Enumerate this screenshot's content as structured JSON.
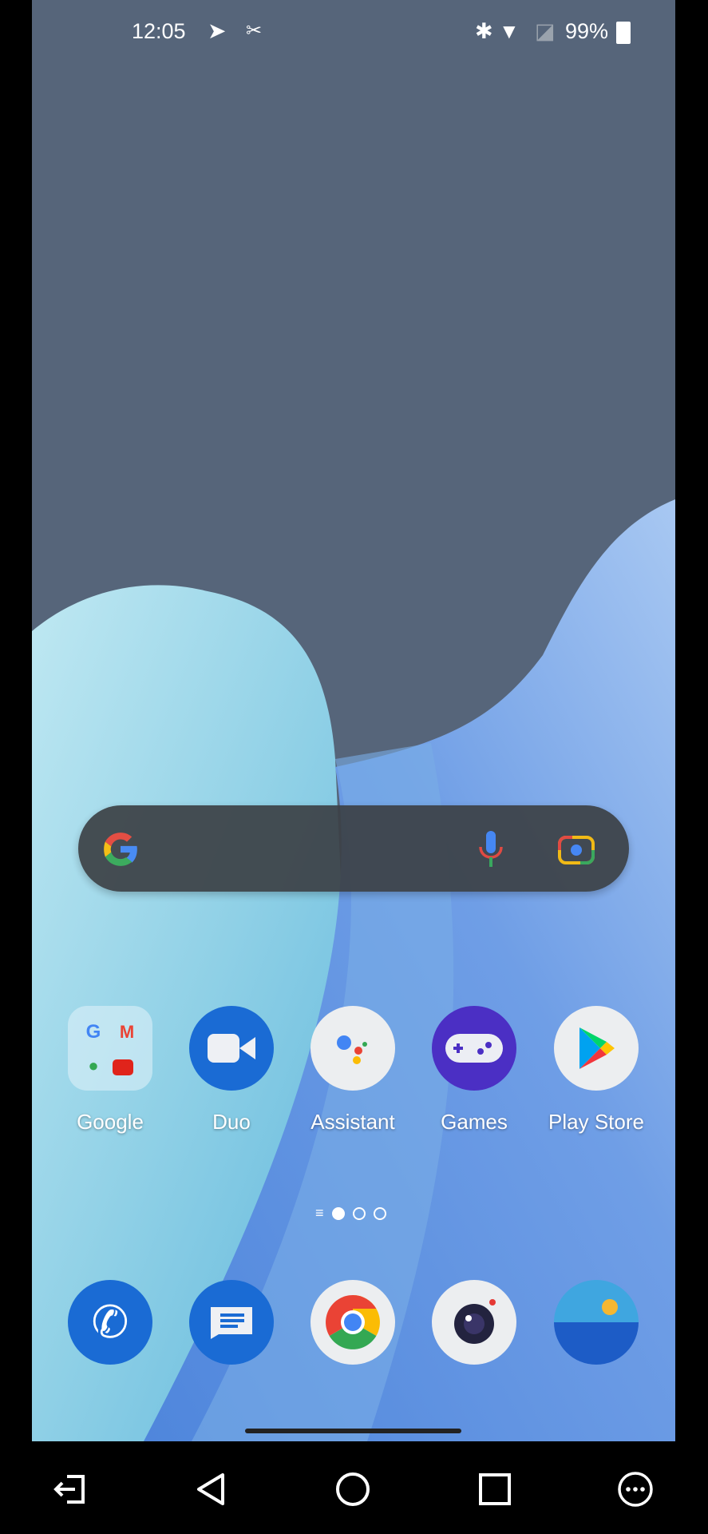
{
  "status_bar": {
    "time": "12:05",
    "battery": "99%",
    "icons": [
      "send-icon",
      "screenshot-scissors-icon",
      "bluetooth-icon",
      "wifi-icon",
      "no-sim-icon",
      "battery-icon"
    ]
  },
  "search_bar": {
    "icons": [
      "google-g-icon",
      "microphone-icon",
      "lens-camera-icon"
    ]
  },
  "apps": [
    {
      "label": "Google"
    },
    {
      "label": "Duo"
    },
    {
      "label": "Assistant"
    },
    {
      "label": "Games"
    },
    {
      "label": "Play Store"
    }
  ],
  "page_indicator": {
    "pages": 3,
    "current": 1
  },
  "dock": [
    "phone",
    "messages",
    "chrome",
    "camera",
    "gallery"
  ],
  "nav_bar": [
    "exit-icon",
    "back-icon",
    "home-icon",
    "recents-icon",
    "more-icon"
  ],
  "colors": {
    "wallpaper_top": "#56657a",
    "accent_blue": "#1a6bd4"
  }
}
